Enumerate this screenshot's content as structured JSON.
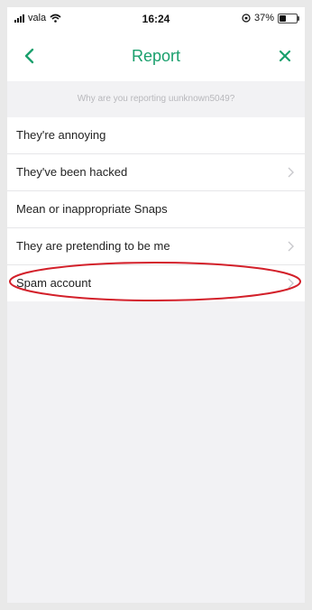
{
  "status_bar": {
    "carrier": "vala",
    "time": "16:24",
    "battery": "37%",
    "battery_level": 0.37
  },
  "nav": {
    "title": "Report",
    "back_icon": "chevron-left-icon",
    "close_icon": "close-icon"
  },
  "prompt": "Why are you reporting uunknown5049?",
  "reasons": [
    {
      "label": "They're annoying",
      "has_chevron": false
    },
    {
      "label": "They've been hacked",
      "has_chevron": true
    },
    {
      "label": "Mean or inappropriate Snaps",
      "has_chevron": false
    },
    {
      "label": "They are pretending to be me",
      "has_chevron": true
    },
    {
      "label": "Spam account",
      "has_chevron": true
    }
  ],
  "colors": {
    "accent": "#1aa06d",
    "highlight_circle": "#d3202a"
  }
}
